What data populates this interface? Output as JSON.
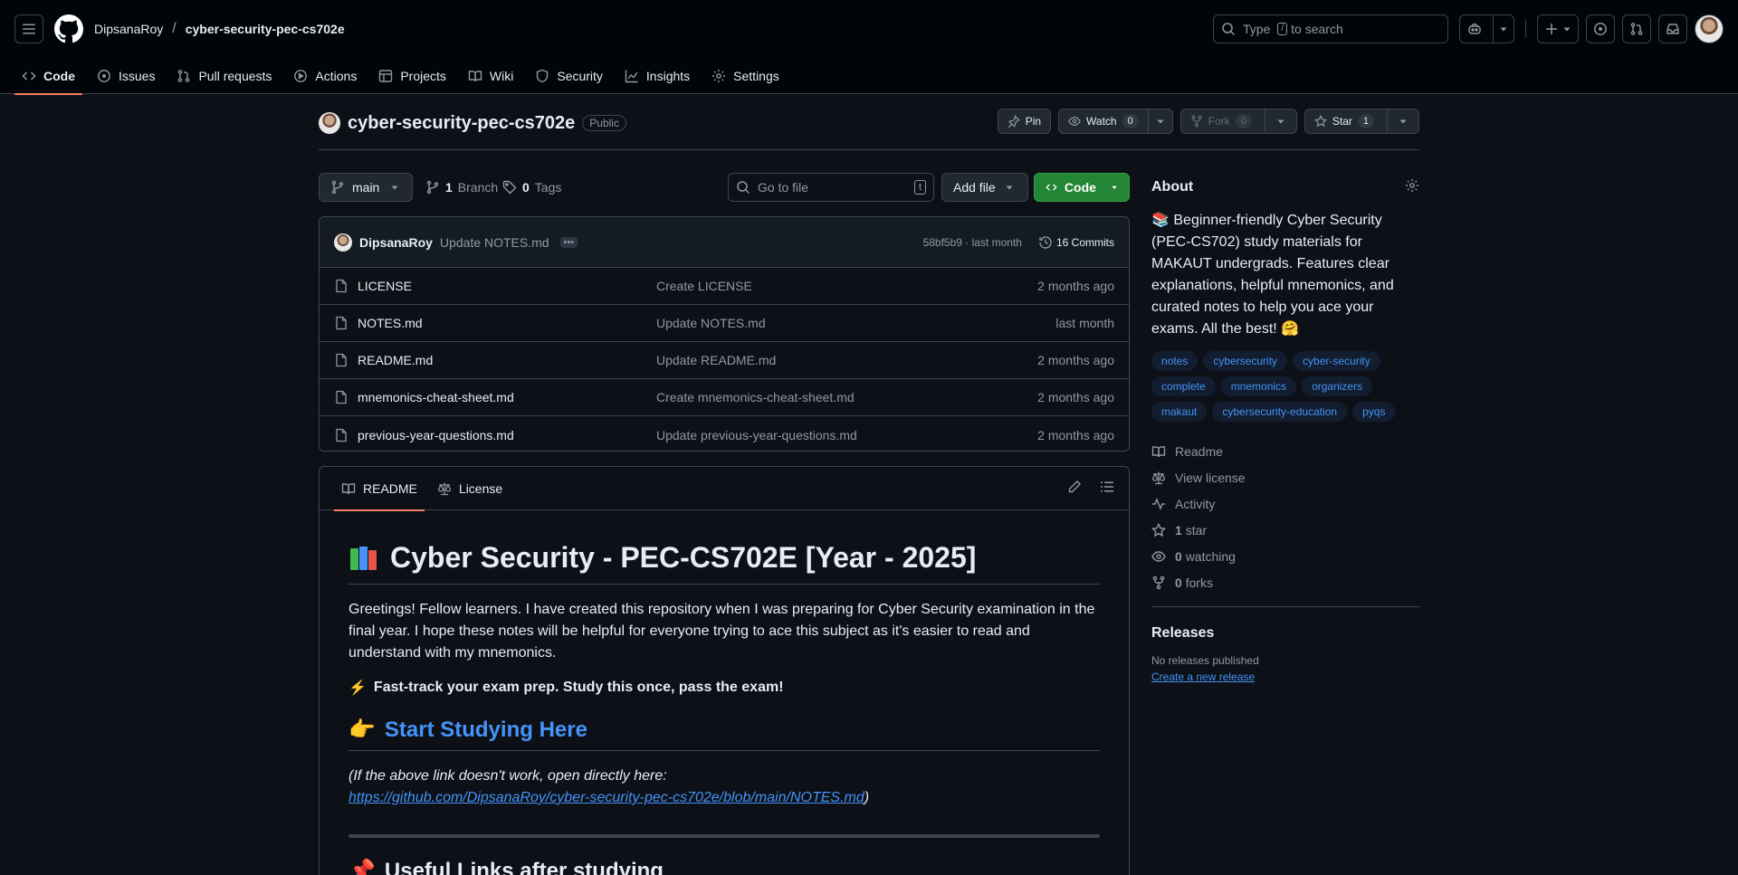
{
  "header": {
    "owner": "DipsanaRoy",
    "separator": "/",
    "repo": "cyber-security-pec-cs702e",
    "search_prefix": "Type",
    "search_key": "/",
    "search_suffix": "to search"
  },
  "nav": {
    "items": [
      {
        "label": "Code",
        "icon": "code-icon"
      },
      {
        "label": "Issues",
        "icon": "issue-icon"
      },
      {
        "label": "Pull requests",
        "icon": "pull-request-icon"
      },
      {
        "label": "Actions",
        "icon": "play-icon"
      },
      {
        "label": "Projects",
        "icon": "table-icon"
      },
      {
        "label": "Wiki",
        "icon": "book-icon"
      },
      {
        "label": "Security",
        "icon": "shield-icon"
      },
      {
        "label": "Insights",
        "icon": "graph-icon"
      },
      {
        "label": "Settings",
        "icon": "gear-icon"
      }
    ]
  },
  "repo": {
    "name": "cyber-security-pec-cs702e",
    "visibility": "Public",
    "pin_label": "Pin",
    "watch_label": "Watch",
    "watch_count": "0",
    "fork_label": "Fork",
    "fork_count": "0",
    "star_label": "Star",
    "star_count": "1"
  },
  "toolbar": {
    "branch": "main",
    "branch_count": "1",
    "branch_label": "Branch",
    "tag_count": "0",
    "tag_label": "Tags",
    "goto_placeholder": "Go to file",
    "goto_key": "t",
    "add_file": "Add file",
    "code": "Code"
  },
  "commit": {
    "author": "DipsanaRoy",
    "message": "Update NOTES.md",
    "hash_time": "58bf5b9 · last month",
    "commits": "16 Commits"
  },
  "files": [
    {
      "name": "LICENSE",
      "message": "Create LICENSE",
      "date": "2 months ago"
    },
    {
      "name": "NOTES.md",
      "message": "Update NOTES.md",
      "date": "last month"
    },
    {
      "name": "README.md",
      "message": "Update README.md",
      "date": "2 months ago"
    },
    {
      "name": "mnemonics-cheat-sheet.md",
      "message": "Create mnemonics-cheat-sheet.md",
      "date": "2 months ago"
    },
    {
      "name": "previous-year-questions.md",
      "message": "Update previous-year-questions.md",
      "date": "2 months ago"
    }
  ],
  "readme": {
    "tab_readme": "README",
    "tab_license": "License",
    "h1": "Cyber Security - PEC-CS702E [Year - 2025]",
    "intro": "Greetings! Fellow learners. I have created this repository when I was preparing for Cyber Security examination in the final year. I hope these notes will be helpful for everyone trying to ace this subject as it's easier to read and understand with my mnemonics.",
    "fast_track_emoji": "⚡",
    "fast_track": "Fast-track your exam prep. Study this once, pass the exam!",
    "start_emoji": "👉",
    "start_link": "Start Studying Here",
    "fallback_text": "(If the above link doesn't work, open directly here:",
    "fallback_url": "https://github.com/DipsanaRoy/cyber-security-pec-cs702e/blob/main/NOTES.md",
    "fallback_close": ")",
    "useful_emoji": "📌",
    "useful_links": "Useful Links after studying"
  },
  "about": {
    "title": "About",
    "description": "📚 Beginner-friendly Cyber Security (PEC-CS702) study materials for MAKAUT undergrads. Features clear explanations, helpful mnemonics, and curated notes to help you ace your exams. All the best! 🤗",
    "topics": [
      "notes",
      "cybersecurity",
      "cyber-security",
      "complete",
      "mnemonics",
      "organizers",
      "makaut",
      "cybersecurity-education",
      "pyqs"
    ],
    "readme": "Readme",
    "license": "View license",
    "activity": "Activity",
    "stars_count": "1",
    "stars_label": "star",
    "watching_count": "0",
    "watching_label": "watching",
    "forks_count": "0",
    "forks_label": "forks"
  },
  "releases": {
    "title": "Releases",
    "none": "No releases published",
    "create": "Create a new release"
  },
  "colors": {
    "accent_underline": "#f78166",
    "link": "#4493f8",
    "code_button": "#238636",
    "background": "#0d1117"
  }
}
